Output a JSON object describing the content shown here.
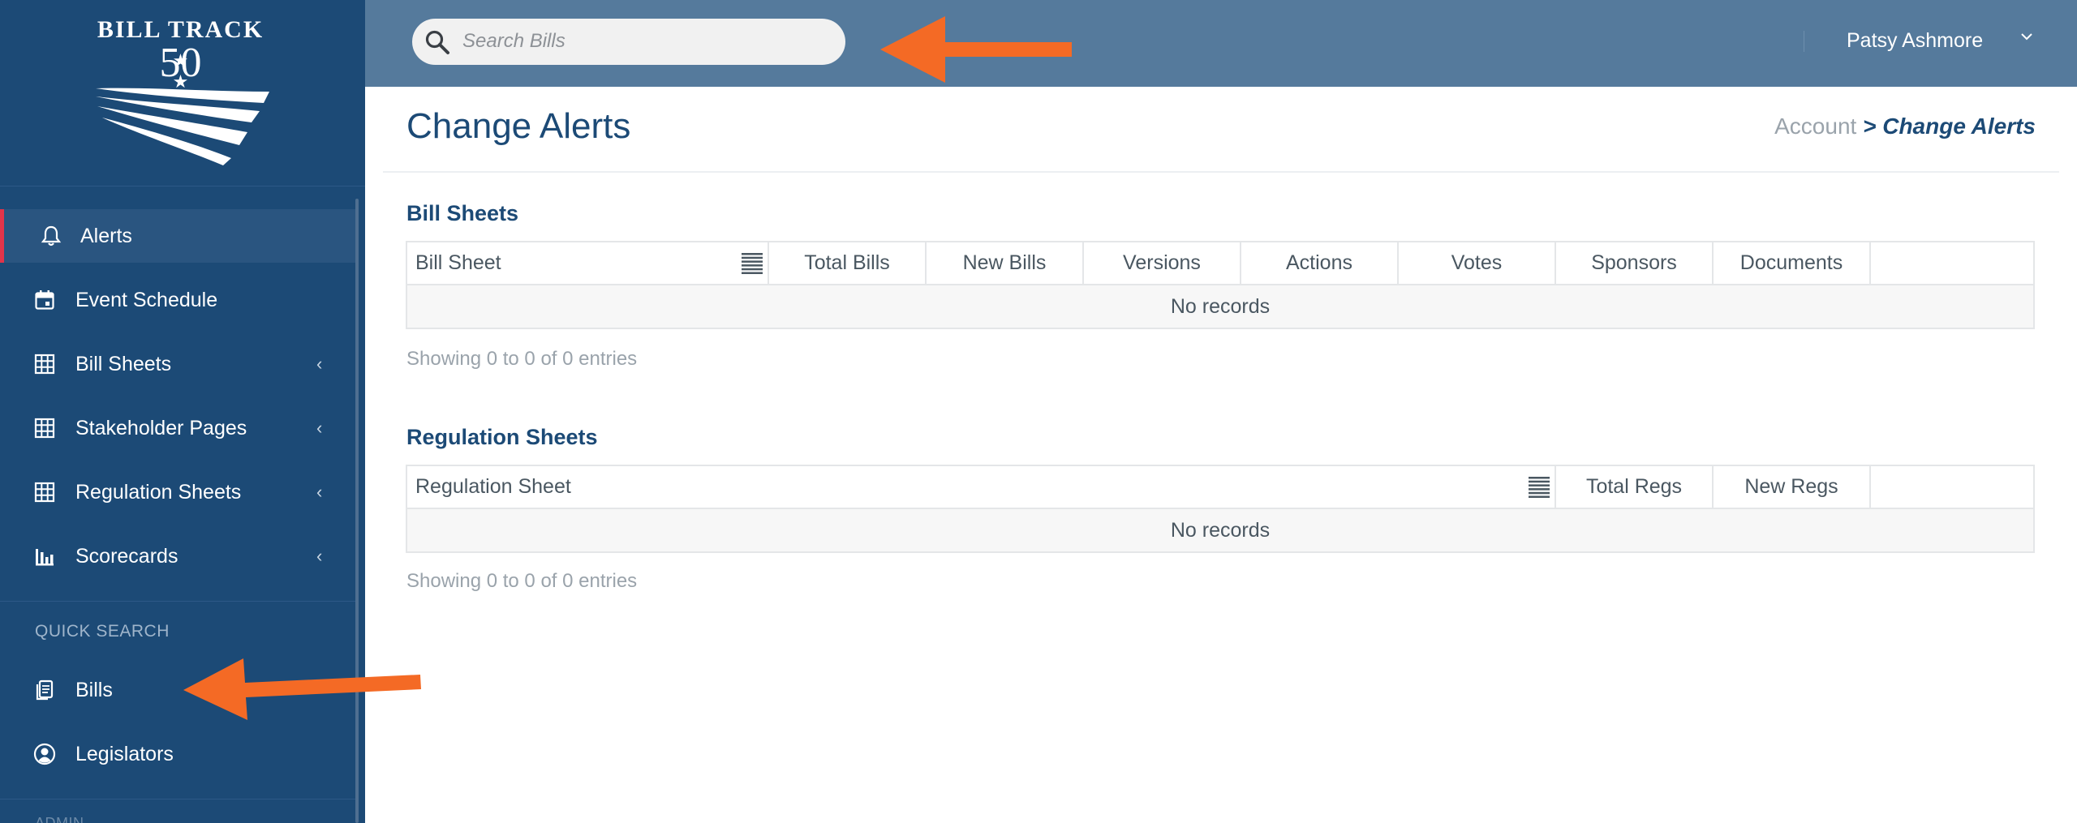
{
  "brand": {
    "line1": "BILL TRACK",
    "number": "50",
    "stars": "★ ★"
  },
  "colors": {
    "sidebar_bg": "#1c4a76",
    "header_bg": "#557a9c",
    "active_marker": "#e2344a",
    "annotation_arrow": "#f46a25",
    "title_blue": "#1c4a76"
  },
  "sidebar": {
    "items": [
      {
        "label": "Alerts",
        "icon": "bell-icon",
        "active": true
      },
      {
        "label": "Event Schedule",
        "icon": "calendar-icon"
      },
      {
        "label": "Bill Sheets",
        "icon": "grid-icon",
        "chevron": "‹"
      },
      {
        "label": "Stakeholder Pages",
        "icon": "grid-icon",
        "chevron": "‹"
      },
      {
        "label": "Regulation Sheets",
        "icon": "grid-icon",
        "chevron": "‹"
      },
      {
        "label": "Scorecards",
        "icon": "bar-chart-icon",
        "chevron": "‹"
      }
    ],
    "quick_search": {
      "label": "QUICK SEARCH",
      "items": [
        {
          "label": "Bills",
          "icon": "document-icon"
        },
        {
          "label": "Legislators",
          "icon": "person-circle-icon"
        }
      ]
    },
    "next_section_label": "ADMIN"
  },
  "header": {
    "search_placeholder": "Search Bills",
    "user_name": "Patsy Ashmore"
  },
  "page": {
    "title": "Change Alerts",
    "breadcrumb": {
      "root": "Account",
      "separator": " > ",
      "current": "Change Alerts"
    }
  },
  "bill_sheets": {
    "title": "Bill Sheets",
    "columns": [
      "Bill Sheet",
      "Total Bills",
      "New Bills",
      "Versions",
      "Actions",
      "Votes",
      "Sponsors",
      "Documents",
      ""
    ],
    "empty_text": "No records",
    "showing": "Showing 0 to 0 of 0 entries"
  },
  "regulation_sheets": {
    "title": "Regulation Sheets",
    "columns": [
      "Regulation Sheet",
      "Total Regs",
      "New Regs",
      ""
    ],
    "empty_text": "No records",
    "showing": "Showing 0 to 0 of 0 entries"
  }
}
